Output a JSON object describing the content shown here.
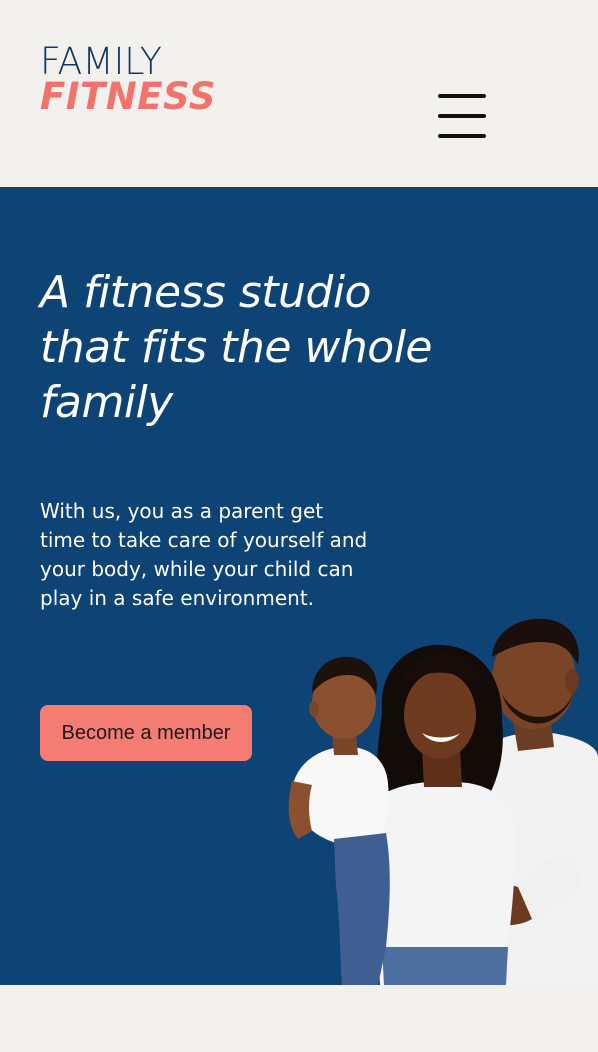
{
  "brand": {
    "logo_top": "FAMILY",
    "logo_bottom": "FITNESS"
  },
  "header": {
    "menu_icon": "hamburger-menu-icon"
  },
  "hero": {
    "title": "A fitness studio that fits the whole family",
    "text": "With us, you as a parent get time to take care of yourself and your body, while your child can play in a safe environment.",
    "cta_label": "Become a member",
    "image_alt": "family-photo"
  },
  "colors": {
    "navy": "#0e4375",
    "coral": "#f47c72",
    "background": "#f3f1ee",
    "logo_coral": "#f2736c",
    "logo_navy": "#14385f"
  }
}
